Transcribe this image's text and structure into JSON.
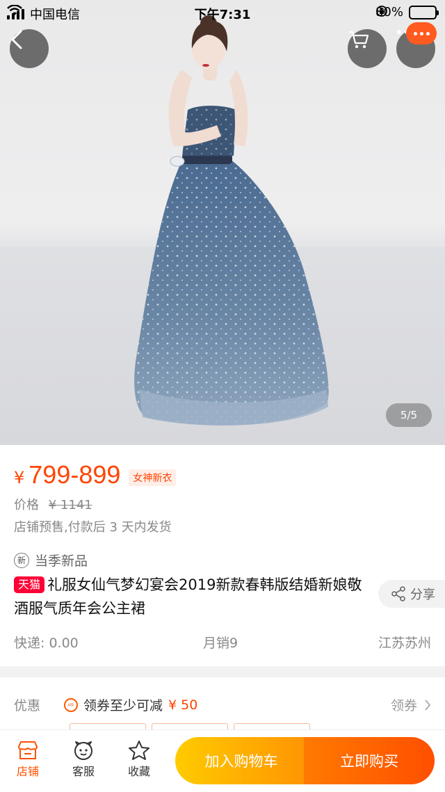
{
  "status_bar": {
    "carrier": "中国电信",
    "time": "下午7:31",
    "battery_pct": "80%",
    "battery_level": 0.8
  },
  "gallery": {
    "counter": "5/5",
    "back_icon": "chevron-left-icon",
    "cart_icon": "cart-icon",
    "more_icon": "more-dots-icon"
  },
  "product": {
    "currency": "¥",
    "price": "799-899",
    "price_tag": "女神新衣",
    "original_label": "价格",
    "original_price": "¥ 1141",
    "presale_note": "店铺预售,付款后 3 天内发货",
    "season_icon_text": "新",
    "season_label": "当季新品",
    "platform_badge": "天猫",
    "title": "礼服女仙气梦幻宴会2019新款春韩版结婚新娘敬酒服气质年会公主裙",
    "share_label": "分享",
    "shipping": "快递: 0.00",
    "monthly_sales": "月销9",
    "location": "江苏苏州"
  },
  "coupon": {
    "label": "优惠",
    "offer_prefix": "领券至少可减",
    "offer_amount": "¥ 50",
    "get_label": "领券"
  },
  "bottom_bar": {
    "store_label": "店铺",
    "service_label": "客服",
    "favorite_label": "收藏",
    "add_cart_label": "加入购物车",
    "buy_now_label": "立即购买"
  },
  "colors": {
    "accent": "#ff4400",
    "tmall_red": "#ff0036",
    "cart_gradient": [
      "#ffcb00",
      "#ff9402"
    ],
    "buy_gradient": [
      "#ff7a00",
      "#ff4f00"
    ]
  }
}
